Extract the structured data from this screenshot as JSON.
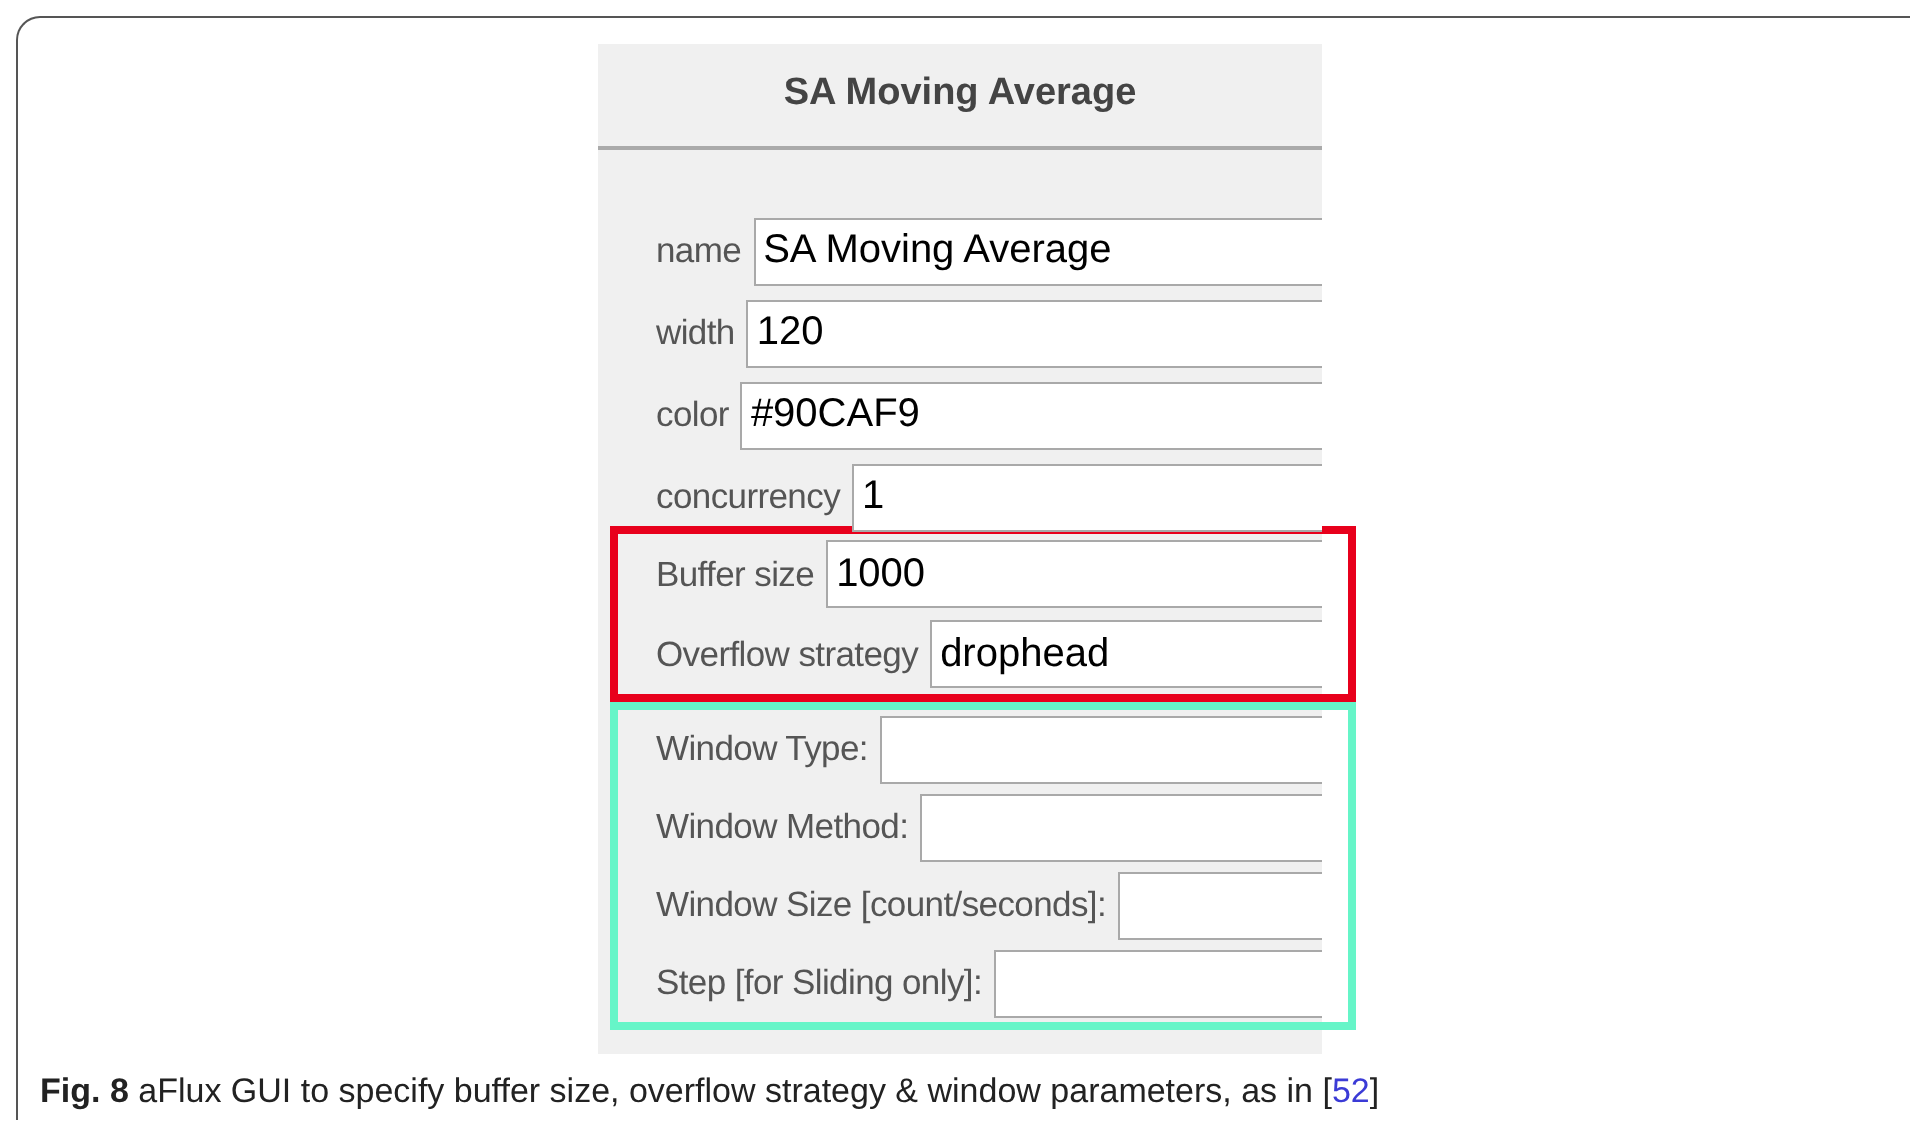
{
  "panel": {
    "title": "SA Moving Average"
  },
  "groups": [
    {
      "fields": [
        {
          "label": "name",
          "value": "SA Moving Average"
        },
        {
          "label": "width",
          "value": "120"
        },
        {
          "label": "color",
          "value": "#90CAF9"
        },
        {
          "label": "concurrency",
          "value": "1"
        }
      ]
    },
    {
      "color": "#e8001c",
      "fields": [
        {
          "label": "Buffer size",
          "value": "1000"
        },
        {
          "label": "Overflow strategy",
          "value": "drophead"
        }
      ]
    },
    {
      "color": "#66f5c8",
      "fields": [
        {
          "label": "Window Type:"
        },
        {
          "label": "Window Method:"
        },
        {
          "label": "Window Size [count/seconds]:"
        },
        {
          "label": "Step [for Sliding only]:"
        }
      ]
    }
  ],
  "caption": {
    "text": "**Fig. 8** aFlux GUI to specify buffer size, overflow strategy & window parameters, as in [",
    "link": "52",
    "after": "]"
  }
}
